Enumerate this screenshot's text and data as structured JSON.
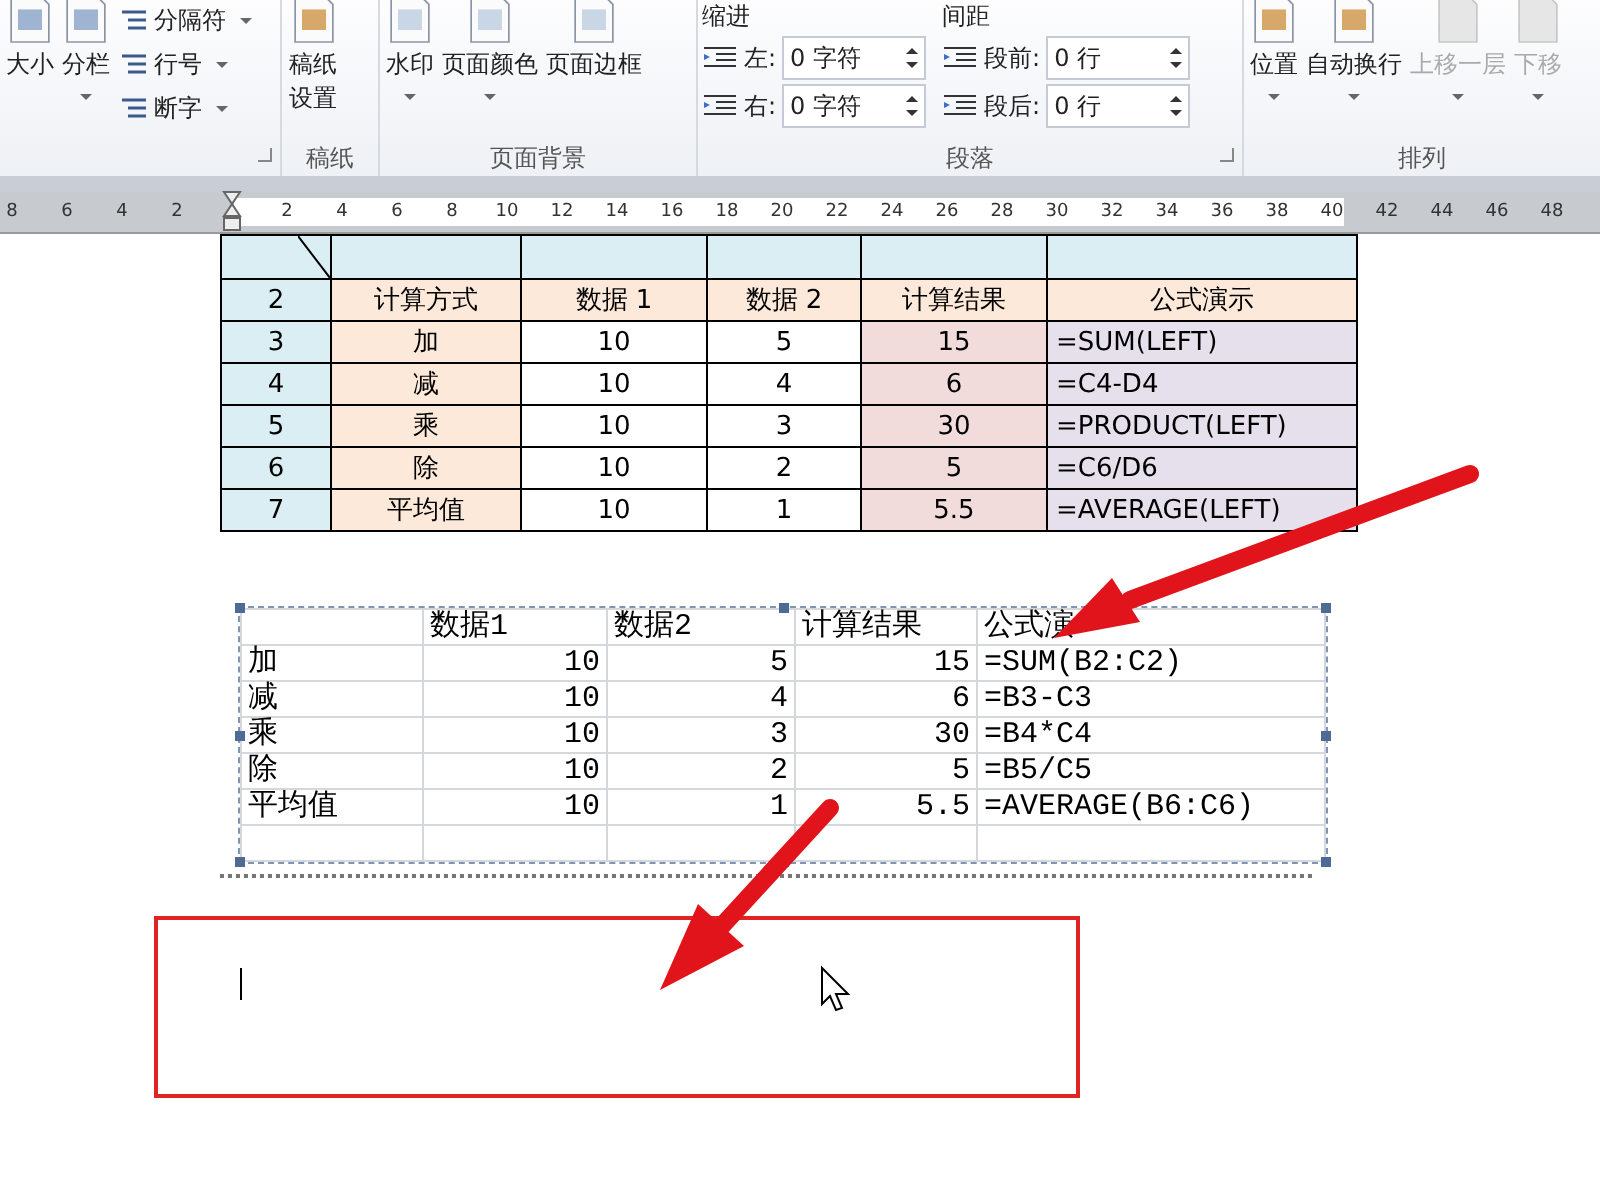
{
  "ribbon": {
    "groups": [
      {
        "launcher": true,
        "items": [
          {
            "kind": "large",
            "label": "大小",
            "dropdown": false,
            "disabled": false
          },
          {
            "kind": "large",
            "label": "分栏",
            "dropdown": true,
            "disabled": false
          },
          {
            "kind": "stack",
            "entries": [
              {
                "label": "分隔符"
              },
              {
                "label": "行号"
              },
              {
                "label": "断字"
              }
            ]
          }
        ]
      },
      {
        "label": "稿纸",
        "launcher": false,
        "items": [
          {
            "kind": "large",
            "label": "稿纸设置",
            "dropdown": false,
            "disabled": false
          }
        ]
      },
      {
        "label": "页面背景",
        "launcher": false,
        "items": [
          {
            "kind": "large",
            "label": "水印",
            "dropdown": true,
            "disabled": false
          },
          {
            "kind": "large",
            "label": "页面颜色",
            "dropdown": true,
            "disabled": false
          },
          {
            "kind": "large",
            "label": "页面边框",
            "dropdown": false,
            "disabled": false
          }
        ]
      },
      {
        "label": "段落",
        "launcher": true,
        "items": [
          {
            "kind": "spinners",
            "heading": "缩进",
            "fields": [
              {
                "label": "左:",
                "value": "0 字符"
              },
              {
                "label": "右:",
                "value": "0 字符"
              }
            ]
          },
          {
            "kind": "spinners",
            "heading": "间距",
            "fields": [
              {
                "label": "段前:",
                "value": "0 行"
              },
              {
                "label": "段后:",
                "value": "0 行"
              }
            ]
          }
        ]
      },
      {
        "label": "排列",
        "launcher": false,
        "items": [
          {
            "kind": "large",
            "label": "位置",
            "dropdown": true,
            "disabled": false
          },
          {
            "kind": "large",
            "label": "自动换行",
            "dropdown": true,
            "disabled": false
          },
          {
            "kind": "large",
            "label": "上移一层",
            "dropdown": true,
            "disabled": true
          },
          {
            "kind": "large",
            "label": "下移",
            "dropdown": true,
            "disabled": true
          }
        ]
      }
    ]
  },
  "ruler": {
    "left_numbers": [
      "8",
      "6",
      "4",
      "2"
    ],
    "right_numbers": [
      "2",
      "4",
      "6",
      "8",
      "10",
      "12",
      "14",
      "16",
      "18",
      "20",
      "22",
      "24",
      "26",
      "28",
      "30",
      "32",
      "34",
      "36",
      "38",
      "40",
      "42",
      "44",
      "46",
      "48"
    ]
  },
  "word_table": {
    "rows": [
      {
        "cells": [
          {
            "color": "#daeef3",
            "diagonal": true
          },
          {
            "color": "#daeef3"
          },
          {
            "color": "#daeef3"
          },
          {
            "color": "#daeef3"
          },
          {
            "color": "#daeef3"
          },
          {
            "color": "#daeef3"
          }
        ]
      },
      {
        "cells": [
          {
            "text": "2",
            "color": "#daeef3"
          },
          {
            "text": "计算方式",
            "color": "#fde9d9"
          },
          {
            "text": "数据 1",
            "color": "#fde9d9"
          },
          {
            "text": "数据 2",
            "color": "#fde9d9"
          },
          {
            "text": "计算结果",
            "color": "#fde9d9"
          },
          {
            "text": "公式演示",
            "color": "#fde9d9"
          }
        ]
      },
      {
        "cells": [
          {
            "text": "3",
            "color": "#daeef3"
          },
          {
            "text": "加",
            "color": "#fde9d9"
          },
          {
            "text": "10",
            "color": "#ffffff"
          },
          {
            "text": "5",
            "color": "#ffffff"
          },
          {
            "text": "15",
            "color": "#f2dcdb"
          },
          {
            "text": "=SUM(LEFT)",
            "color": "#e5e0ec"
          }
        ]
      },
      {
        "cells": [
          {
            "text": "4",
            "color": "#daeef3"
          },
          {
            "text": "减",
            "color": "#fde9d9"
          },
          {
            "text": "10",
            "color": "#ffffff"
          },
          {
            "text": "4",
            "color": "#ffffff"
          },
          {
            "text": "6",
            "color": "#f2dcdb"
          },
          {
            "text": "=C4-D4",
            "color": "#e5e0ec"
          }
        ]
      },
      {
        "cells": [
          {
            "text": "5",
            "color": "#daeef3"
          },
          {
            "text": "乘",
            "color": "#fde9d9"
          },
          {
            "text": "10",
            "color": "#ffffff"
          },
          {
            "text": "3",
            "color": "#ffffff"
          },
          {
            "text": "30",
            "color": "#f2dcdb"
          },
          {
            "text": "=PRODUCT(LEFT)",
            "color": "#e5e0ec"
          }
        ]
      },
      {
        "cells": [
          {
            "text": "6",
            "color": "#daeef3"
          },
          {
            "text": "除",
            "color": "#fde9d9"
          },
          {
            "text": "10",
            "color": "#ffffff"
          },
          {
            "text": "2",
            "color": "#ffffff"
          },
          {
            "text": "5",
            "color": "#f2dcdb"
          },
          {
            "text": "=C6/D6",
            "color": "#e5e0ec"
          }
        ]
      },
      {
        "cells": [
          {
            "text": "7",
            "color": "#daeef3"
          },
          {
            "text": "平均值",
            "color": "#fde9d9"
          },
          {
            "text": "10",
            "color": "#ffffff"
          },
          {
            "text": "1",
            "color": "#ffffff"
          },
          {
            "text": "5.5",
            "color": "#f2dcdb"
          },
          {
            "text": "=AVERAGE(LEFT)",
            "color": "#e5e0ec"
          }
        ]
      }
    ]
  },
  "sheet_table": {
    "rows": [
      {
        "kind": "header",
        "cells": [
          null,
          "数据1",
          "数据2",
          "计算结果",
          "公式演"
        ]
      },
      {
        "kind": "data",
        "cells": [
          "加",
          "10",
          "5",
          "15",
          "=SUM(B2:C2)"
        ]
      },
      {
        "kind": "data",
        "cells": [
          "减",
          "10",
          "4",
          "6",
          "=B3-C3"
        ]
      },
      {
        "kind": "data",
        "cells": [
          "乘",
          "10",
          "3",
          "30",
          "=B4*C4"
        ]
      },
      {
        "kind": "data",
        "cells": [
          "除",
          "10",
          "2",
          "5",
          "=B5/C5"
        ]
      },
      {
        "kind": "data",
        "cells": [
          "平均值",
          "10",
          "1",
          "5.5",
          "=AVERAGE(B6:C6)"
        ]
      },
      {
        "kind": "blank"
      }
    ]
  }
}
